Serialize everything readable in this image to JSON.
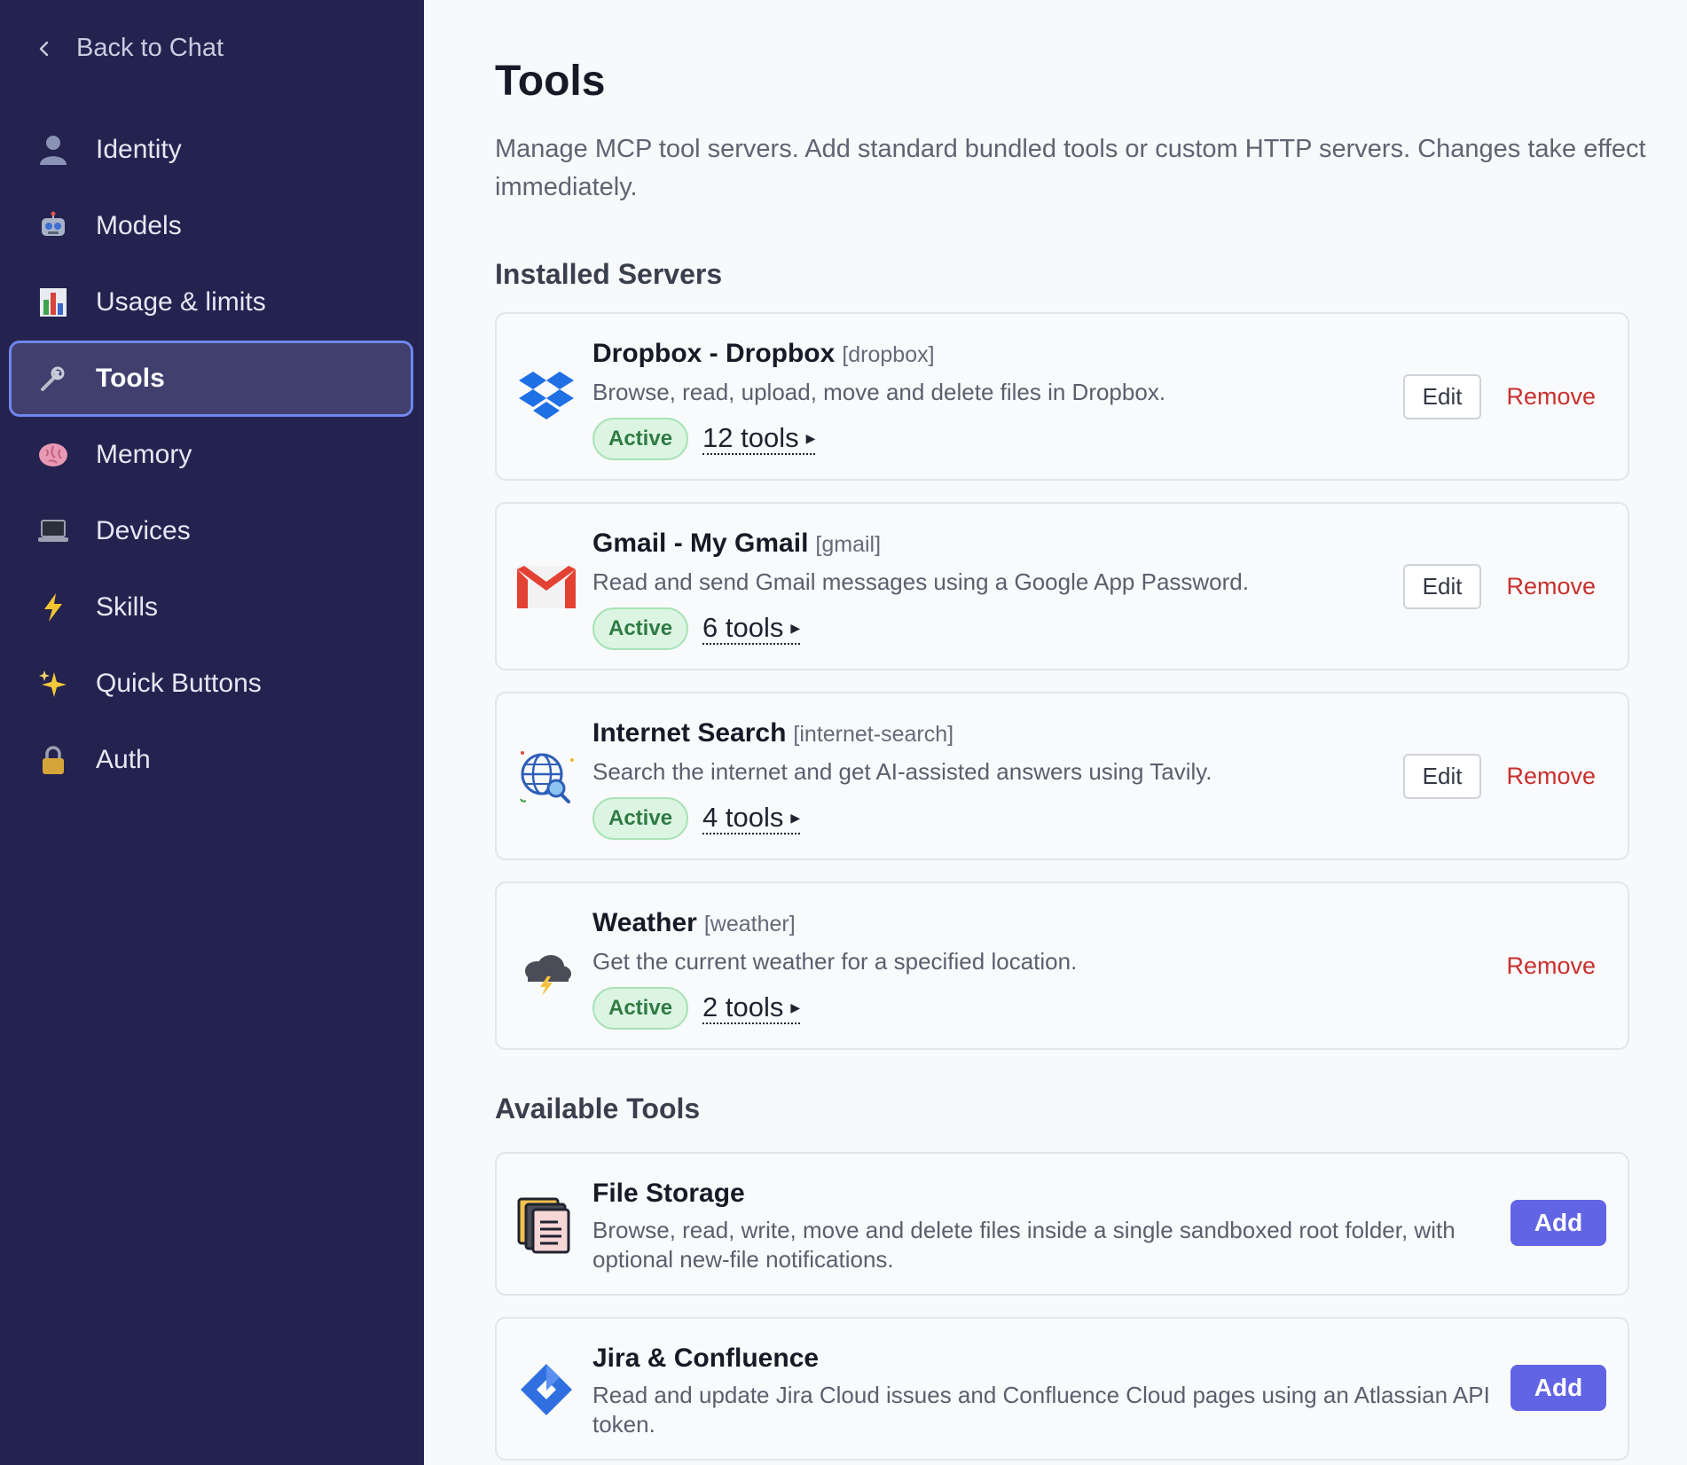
{
  "sidebar": {
    "back_label": "Back to Chat",
    "items": [
      {
        "label": "Identity",
        "icon": "person-icon"
      },
      {
        "label": "Models",
        "icon": "robot-icon"
      },
      {
        "label": "Usage & limits",
        "icon": "bar-chart-icon"
      },
      {
        "label": "Tools",
        "icon": "wrench-icon",
        "active": true
      },
      {
        "label": "Memory",
        "icon": "brain-icon"
      },
      {
        "label": "Devices",
        "icon": "laptop-icon"
      },
      {
        "label": "Skills",
        "icon": "lightning-icon"
      },
      {
        "label": "Quick Buttons",
        "icon": "sparkles-icon"
      },
      {
        "label": "Auth",
        "icon": "lock-icon"
      }
    ]
  },
  "main": {
    "title": "Tools",
    "description": "Manage MCP tool servers. Add standard bundled tools or custom HTTP servers. Changes take effect immediately.",
    "installed_title": "Installed Servers",
    "available_title": "Available Tools",
    "servers": [
      {
        "name": "Dropbox - Dropbox",
        "slug": "[dropbox]",
        "description": "Browse, read, upload, move and delete files in Dropbox.",
        "status": "Active",
        "tools": "12 tools",
        "edit": "Edit",
        "remove": "Remove",
        "icon": "dropbox-icon"
      },
      {
        "name": "Gmail - My Gmail",
        "slug": "[gmail]",
        "description": "Read and send Gmail messages using a Google App Password.",
        "status": "Active",
        "tools": "6 tools",
        "edit": "Edit",
        "remove": "Remove",
        "icon": "gmail-icon"
      },
      {
        "name": "Internet Search",
        "slug": "[internet-search]",
        "description": "Search the internet and get AI-assisted answers using Tavily.",
        "status": "Active",
        "tools": "4 tools",
        "edit": "Edit",
        "remove": "Remove",
        "icon": "globe-search-icon"
      },
      {
        "name": "Weather",
        "slug": "[weather]",
        "description": "Get the current weather for a specified location.",
        "status": "Active",
        "tools": "2 tools",
        "remove": "Remove",
        "icon": "weather-storm-icon"
      }
    ],
    "available": [
      {
        "name": "File Storage",
        "description": "Browse, read, write, move and delete files inside a single sandboxed root folder, with optional new-file notifications.",
        "add": "Add",
        "icon": "file-cabinet-icon"
      },
      {
        "name": "Jira & Confluence",
        "description": "Read and update Jira Cloud issues and Confluence Cloud pages using an Atlassian API token.",
        "add": "Add",
        "icon": "jira-icon"
      }
    ]
  },
  "colors": {
    "sidebar_bg": "#24224f",
    "active_border": "#6f86ee",
    "badge_green": "#2f7b44",
    "remove_red": "#c8302d",
    "add_blue": "#6164e4"
  }
}
